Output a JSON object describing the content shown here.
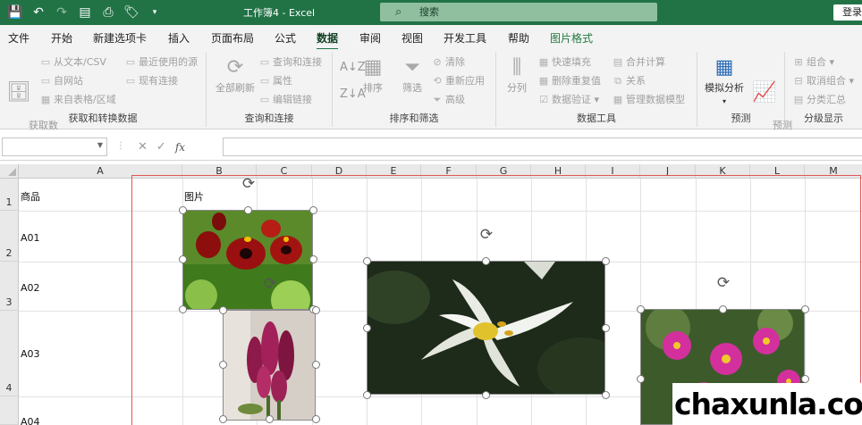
{
  "titlebar": {
    "title": "工作簿4  -  Excel",
    "search_placeholder": "搜索",
    "signin_label": "登录",
    "qat_icons": [
      "save-icon",
      "undo-icon",
      "redo-icon",
      "form-icon",
      "print-preview-icon",
      "tag-icon",
      "customize-icon"
    ]
  },
  "menu": {
    "tabs": [
      "文件",
      "开始",
      "新建选项卡",
      "插入",
      "页面布局",
      "公式",
      "数据",
      "审阅",
      "视图",
      "开发工具",
      "帮助",
      "图片格式"
    ],
    "active": "数据",
    "context_tab": "图片格式"
  },
  "ribbon": {
    "get_transform": {
      "label": "获取和转换数据",
      "get_data": "获取数\n据",
      "from_text": "从文本/CSV",
      "from_web": "自网站",
      "from_table": "来自表格/区域",
      "recent_sources": "最近使用的源",
      "existing_connections": "现有连接"
    },
    "queries": {
      "label": "查询和连接",
      "refresh_all": "全部刷新",
      "queries_connections": "查询和连接",
      "properties": "属性",
      "edit_links": "编辑链接"
    },
    "sort_filter": {
      "label": "排序和筛选",
      "sort": "排序",
      "filter": "筛选",
      "clear": "清除",
      "reapply": "重新应用",
      "advanced": "高级"
    },
    "data_tools": {
      "label": "数据工具",
      "split": "分列",
      "flash_fill": "快速填充",
      "remove_dup": "删除重复值",
      "validation": "数据验证",
      "consolidate": "合并计算",
      "relations": "关系",
      "data_model": "管理数据模型"
    },
    "forecast": {
      "label": "预测",
      "what_if": "模拟分析",
      "forecast_sheet": "预测\n工作表"
    },
    "outline": {
      "label": "分级显示",
      "group": "组合",
      "ungroup": "取消组合",
      "subtotal": "分类汇总"
    }
  },
  "formula_bar": {
    "name_box": "",
    "cancel_glyph": "✕",
    "enter_glyph": "✓",
    "fx_label": "fx",
    "formula": ""
  },
  "sheet": {
    "columns": [
      "A",
      "B",
      "C",
      "D",
      "E",
      "F",
      "G",
      "H",
      "I",
      "J",
      "K",
      "L",
      "M"
    ],
    "rows": [
      "1",
      "2",
      "3",
      "4"
    ],
    "cells": {
      "A1": "商品",
      "B1": "图片",
      "A2": "A01",
      "A3": "A02",
      "A4": "A03",
      "A5": "A04"
    },
    "pictures": [
      "pansy-flowers",
      "tulip-buds",
      "white-lily",
      "pink-cosmos"
    ]
  },
  "watermark": "chaxunla.com"
}
